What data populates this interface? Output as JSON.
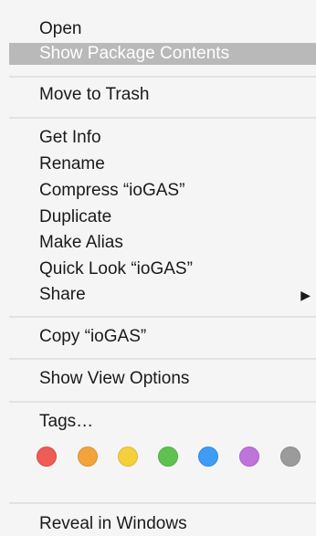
{
  "menu": {
    "items": [
      {
        "label": "Open"
      },
      {
        "label": "Show Package Contents"
      },
      {
        "label": "Move to Trash"
      },
      {
        "label": "Get Info"
      },
      {
        "label": "Rename"
      },
      {
        "label": "Compress “ioGAS”"
      },
      {
        "label": "Duplicate"
      },
      {
        "label": "Make Alias"
      },
      {
        "label": "Quick Look “ioGAS”"
      },
      {
        "label": "Share"
      },
      {
        "label": "Copy “ioGAS”"
      },
      {
        "label": "Show View Options"
      },
      {
        "label": "Tags…"
      },
      {
        "label": "Reveal in Windows"
      }
    ],
    "submenu_arrow": "▶",
    "highlighted_item": "Show Package Contents"
  },
  "tags": {
    "colors": [
      {
        "name": "red-tag",
        "fill": "#ef5b55",
        "stroke": "#d94a45"
      },
      {
        "name": "orange-tag",
        "fill": "#f2a33c",
        "stroke": "#dc9033"
      },
      {
        "name": "yellow-tag",
        "fill": "#f5cf3c",
        "stroke": "#ddb933"
      },
      {
        "name": "green-tag",
        "fill": "#5ec34e",
        "stroke": "#4fae41"
      },
      {
        "name": "blue-tag",
        "fill": "#3f9cf5",
        "stroke": "#338ade"
      },
      {
        "name": "purple-tag",
        "fill": "#bf74db",
        "stroke": "#a963c4"
      },
      {
        "name": "gray-tag",
        "fill": "#9b9b9b",
        "stroke": "#888888"
      }
    ]
  },
  "colors": {
    "menu_background": "#f5f5f5",
    "highlight": "#b9b9b9",
    "separator": "#e2e2e2",
    "text": "#1a1a1a"
  }
}
